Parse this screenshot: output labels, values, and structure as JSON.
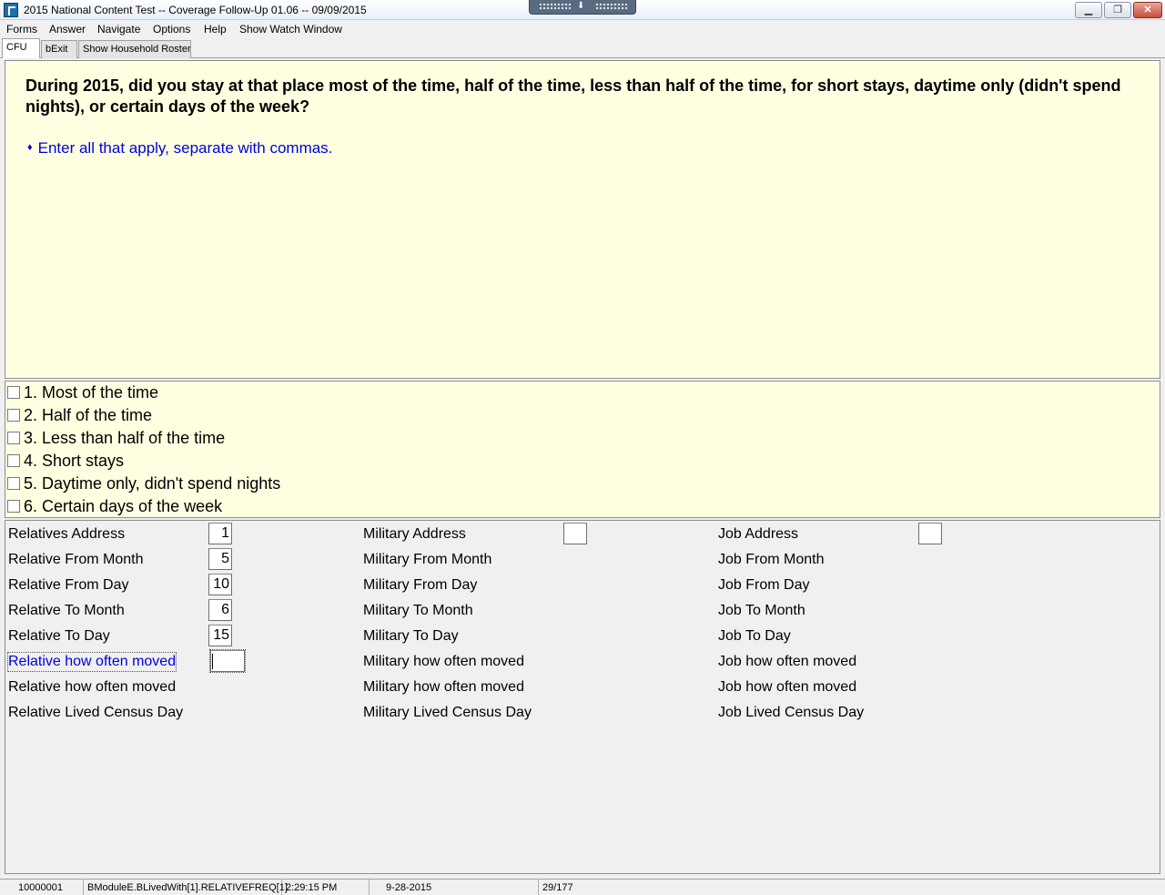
{
  "window": {
    "title": "2015 National Content Test -- Coverage Follow-Up 01.06 -- 09/09/2015",
    "minimize": "▁",
    "maximize": "❐",
    "close": "✕"
  },
  "menu": [
    "Forms",
    "Answer",
    "Navigate",
    "Options",
    "Help",
    "Show Watch Window"
  ],
  "tabs": [
    {
      "label": "CFU",
      "active": true
    },
    {
      "label": "bExit",
      "active": false
    },
    {
      "label": "Show Household Roster",
      "active": false
    }
  ],
  "question": {
    "text": "During 2015, did you stay at that place most of the time, half of the time, less than half of the time, for short stays, daytime only (didn't spend nights), or certain days of the week?",
    "instruction": "Enter all that apply, separate with commas.",
    "instruction_bullet": "♦"
  },
  "options": [
    {
      "label": "1. Most of the time",
      "checked": false
    },
    {
      "label": "2. Half of the time",
      "checked": false
    },
    {
      "label": "3. Less than half of the time",
      "checked": false
    },
    {
      "label": "4. Short stays",
      "checked": false
    },
    {
      "label": "5. Daytime only, didn't spend nights",
      "checked": false
    },
    {
      "label": "6. Certain days of the week",
      "checked": false
    }
  ],
  "fields": {
    "relative": [
      {
        "label": "Relatives Address",
        "value": "1",
        "has_box": true
      },
      {
        "label": "Relative From Month",
        "value": "5",
        "has_box": true
      },
      {
        "label": "Relative From Day",
        "value": "10",
        "has_box": true
      },
      {
        "label": "Relative To Month",
        "value": "6",
        "has_box": true
      },
      {
        "label": "Relative To Day",
        "value": "15",
        "has_box": true
      },
      {
        "label": "Relative how often moved",
        "value": "",
        "has_box": true,
        "current": true
      },
      {
        "label": "Relative how often moved",
        "value": "",
        "has_box": false
      },
      {
        "label": "Relative Lived Census Day",
        "value": "",
        "has_box": false
      }
    ],
    "military": [
      {
        "label": "Military Address",
        "value": "",
        "has_box": true
      },
      {
        "label": "Military From Month",
        "value": "",
        "has_box": false
      },
      {
        "label": "Military From Day",
        "value": "",
        "has_box": false
      },
      {
        "label": "Military To Month",
        "value": "",
        "has_box": false
      },
      {
        "label": "Military To Day",
        "value": "",
        "has_box": false
      },
      {
        "label": "Military how often moved",
        "value": "",
        "has_box": false
      },
      {
        "label": "Military how often moved",
        "value": "",
        "has_box": false
      },
      {
        "label": "Military Lived Census Day",
        "value": "",
        "has_box": false
      }
    ],
    "job": [
      {
        "label": "Job Address",
        "value": "",
        "has_box": true
      },
      {
        "label": "Job From Month",
        "value": "",
        "has_box": false
      },
      {
        "label": "Job From Day",
        "value": "",
        "has_box": false
      },
      {
        "label": "Job To Month",
        "value": "",
        "has_box": false
      },
      {
        "label": "Job To Day",
        "value": "",
        "has_box": false
      },
      {
        "label": "Job how often moved",
        "value": "",
        "has_box": false
      },
      {
        "label": "Job how often moved",
        "value": "",
        "has_box": false
      },
      {
        "label": "Job Lived Census Day",
        "value": "",
        "has_box": false
      }
    ]
  },
  "status": {
    "case_id": "10000001",
    "field_path": "BModuleE.BLivedWith[1].RELATIVEFREQ[1]",
    "time": "2:29:15 PM",
    "date": "9-28-2015",
    "progress": "29/177"
  }
}
